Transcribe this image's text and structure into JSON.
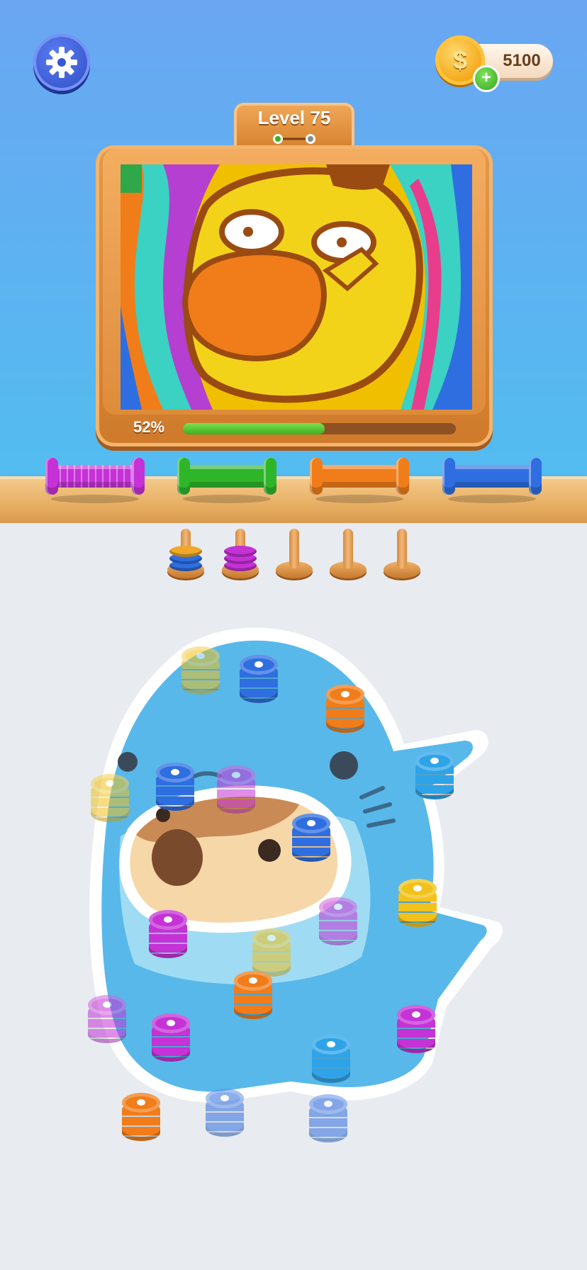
{
  "header": {
    "settings_icon": "gear-icon",
    "coins": "5100",
    "coin_symbol": "$",
    "add_coins_label": "+"
  },
  "level": {
    "title": "Level 75"
  },
  "picture": {
    "progress_label": "52%",
    "progress_fraction": 0.52
  },
  "spools": [
    {
      "color": "purple",
      "hex": "#c532d6",
      "filled": true
    },
    {
      "color": "green",
      "hex": "#2fb52a",
      "filled": false
    },
    {
      "color": "orange",
      "hex": "#f07d1a",
      "filled": false
    },
    {
      "color": "blue",
      "hex": "#2f6ee0",
      "filled": false
    }
  ],
  "holding_pegs": [
    {
      "rings": [
        "#2f6ee0",
        "#2f6ee0",
        "#f0a82a"
      ]
    },
    {
      "rings": [
        "#c532d6",
        "#c532d6",
        "#c532d6"
      ]
    },
    {
      "rings": []
    },
    {
      "rings": []
    },
    {
      "rings": []
    }
  ],
  "yarn_stacks": [
    {
      "color": "#f2c21a",
      "dim": true
    },
    {
      "color": "#2f6ee0",
      "dim": false
    },
    {
      "color": "#f07d1a",
      "dim": false
    },
    {
      "color": "#f2c21a",
      "dim": true
    },
    {
      "color": "#2f6ee0",
      "dim": false
    },
    {
      "color": "#c532d6",
      "dim": true
    },
    {
      "color": "#2ea3e8",
      "dim": false
    },
    {
      "color": "#2f6ee0",
      "dim": false
    },
    {
      "color": "#c532d6",
      "dim": false
    },
    {
      "color": "#c532d6",
      "dim": true
    },
    {
      "color": "#f2c21a",
      "dim": false
    },
    {
      "color": "#f2c21a",
      "dim": true
    },
    {
      "color": "#f07d1a",
      "dim": false
    },
    {
      "color": "#c532d6",
      "dim": true
    },
    {
      "color": "#c532d6",
      "dim": false
    },
    {
      "color": "#2ea3e8",
      "dim": false
    },
    {
      "color": "#c532d6",
      "dim": false
    },
    {
      "color": "#f07d1a",
      "dim": false
    },
    {
      "color": "#2f6ee0",
      "dim": true
    },
    {
      "color": "#2f6ee0",
      "dim": true
    }
  ],
  "colors": {
    "sky": "#5fb2f2",
    "wood": "#e39a4a",
    "floor": "#e8ecf1",
    "progress": "#3cae22"
  }
}
